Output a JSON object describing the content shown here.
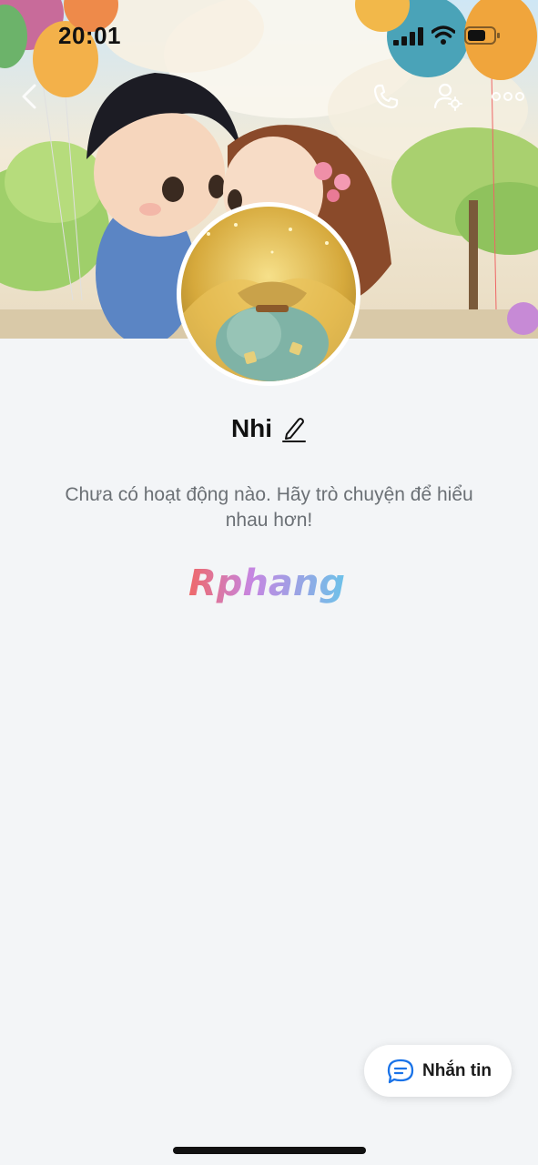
{
  "status_bar": {
    "time": "20:01"
  },
  "profile": {
    "name": "Nhi",
    "empty_activity_text": "Chưa có hoạt động nào. Hãy trò chuyện để hiểu nhau hơn!",
    "watermark_text": "Rphang"
  },
  "actions": {
    "message_label": "Nhắn tin"
  },
  "icons": {
    "back": "chevron-left-icon",
    "call": "phone-icon",
    "friend_settings": "user-gear-icon",
    "more": "ellipsis-icon",
    "edit": "pencil-icon",
    "message": "chat-bubble-icon"
  },
  "colors": {
    "background": "#f3f5f7",
    "accent": "#1a73e8"
  }
}
